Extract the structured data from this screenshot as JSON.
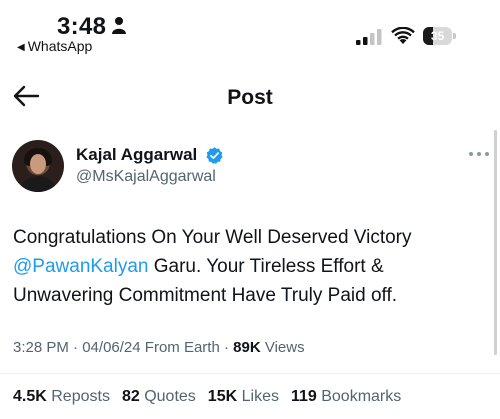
{
  "status_bar": {
    "time": "3:48",
    "back_app": "WhatsApp",
    "battery_percent": "35"
  },
  "header": {
    "title": "Post"
  },
  "author": {
    "name": "Kajal Aggarwal",
    "handle": "@MsKajalAggarwal",
    "verified": true
  },
  "post": {
    "text_before": "Congratulations On Your Well Deserved Victory ",
    "mention": "@PawanKalyan",
    "text_after": " Garu. Your Tireless Effort & Unwavering Commitment Have Truly Paid off."
  },
  "meta": {
    "time": "3:28 PM",
    "date": "04/06/24",
    "location": "From Earth",
    "views_count": "89K",
    "views_label": "Views",
    "sep": "·"
  },
  "stats": {
    "reposts_count": "4.5K",
    "reposts_label": "Reposts",
    "quotes_count": "82",
    "quotes_label": "Quotes",
    "likes_count": "15K",
    "likes_label": "Likes",
    "bookmarks_count": "119",
    "bookmarks_label": "Bookmarks"
  },
  "colors": {
    "link": "#1d9bf0",
    "secondary_text": "#536471",
    "primary_text": "#0f1419"
  },
  "icons": [
    "person-icon",
    "signal-icon",
    "wifi-icon",
    "battery-icon",
    "back-arrow-icon",
    "verified-badge-icon",
    "more-icon"
  ]
}
